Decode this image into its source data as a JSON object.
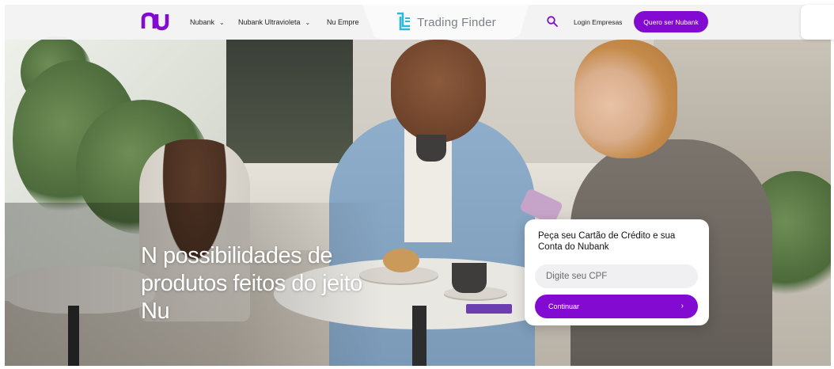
{
  "header": {
    "logo_alt": "nu",
    "nav": [
      {
        "label": "Nubank",
        "has_dropdown": true
      },
      {
        "label": "Nubank Ultravioleta",
        "has_dropdown": true
      },
      {
        "label": "Nu Empre"
      }
    ],
    "watermark": {
      "text": "Trading Finder",
      "icon": "trading-finder-logo-icon"
    },
    "search_icon": "search-icon",
    "login_label": "Login Empresas",
    "cta_label": "Quero ser Nubank"
  },
  "hero": {
    "title": "N possibilidades de produtos feitos do jeito Nu"
  },
  "signup_card": {
    "title": "Peça seu Cartão de Crédito e sua Conta do Nubank",
    "cpf_placeholder": "Digite seu CPF",
    "button_label": "Continuar",
    "button_icon": "chevron-right-icon"
  },
  "colors": {
    "brand_purple": "#820ad1",
    "header_bg": "#f5f4f6",
    "card_bg": "#ffffff",
    "input_bg": "#f0f0f2"
  }
}
